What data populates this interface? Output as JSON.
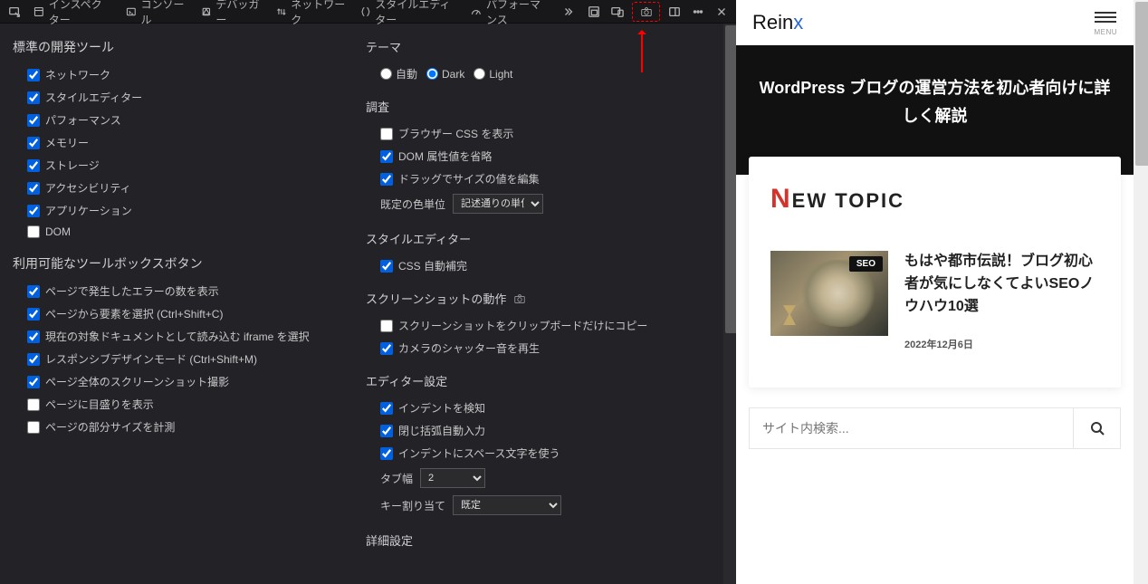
{
  "toolbar": {
    "tabs": [
      {
        "id": "inspector",
        "label": "インスペクター"
      },
      {
        "id": "console",
        "label": "コンソール"
      },
      {
        "id": "debugger",
        "label": "デバッガー"
      },
      {
        "id": "network",
        "label": "ネットワーク"
      },
      {
        "id": "styleeditor",
        "label": "スタイルエディター"
      },
      {
        "id": "performance",
        "label": "パフォーマンス"
      }
    ]
  },
  "settings": {
    "default_tools": {
      "title": "標準の開発ツール",
      "items": [
        {
          "label": "ネットワーク",
          "checked": true
        },
        {
          "label": "スタイルエディター",
          "checked": true
        },
        {
          "label": "パフォーマンス",
          "checked": true
        },
        {
          "label": "メモリー",
          "checked": true
        },
        {
          "label": "ストレージ",
          "checked": true
        },
        {
          "label": "アクセシビリティ",
          "checked": true
        },
        {
          "label": "アプリケーション",
          "checked": true
        },
        {
          "label": "DOM",
          "checked": false
        }
      ]
    },
    "toolbox_buttons": {
      "title": "利用可能なツールボックスボタン",
      "items": [
        {
          "label": "ページで発生したエラーの数を表示",
          "checked": true
        },
        {
          "label": "ページから要素を選択 (Ctrl+Shift+C)",
          "checked": true
        },
        {
          "label": "現在の対象ドキュメントとして読み込む iframe を選択",
          "checked": true
        },
        {
          "label": "レスポンシブデザインモード (Ctrl+Shift+M)",
          "checked": true
        },
        {
          "label": "ページ全体のスクリーンショット撮影",
          "checked": true
        },
        {
          "label": "ページに目盛りを表示",
          "checked": false
        },
        {
          "label": "ページの部分サイズを計測",
          "checked": false
        }
      ]
    },
    "theme": {
      "title": "テーマ",
      "options": [
        "自動",
        "Dark",
        "Light"
      ],
      "selected": "Dark"
    },
    "inspection": {
      "title": "調査",
      "items": [
        {
          "label": "ブラウザー CSS を表示",
          "checked": false
        },
        {
          "label": "DOM 属性値を省略",
          "checked": true
        },
        {
          "label": "ドラッグでサイズの値を編集",
          "checked": true
        }
      ],
      "color_unit_label": "既定の色単位",
      "color_unit_value": "記述通りの単位"
    },
    "style_editor": {
      "title": "スタイルエディター",
      "items": [
        {
          "label": "CSS 自動補完",
          "checked": true
        }
      ]
    },
    "screenshot": {
      "title": "スクリーンショットの動作",
      "items": [
        {
          "label": "スクリーンショットをクリップボードだけにコピー",
          "checked": false
        },
        {
          "label": "カメラのシャッター音を再生",
          "checked": true
        }
      ]
    },
    "editor": {
      "title": "エディター設定",
      "items": [
        {
          "label": "インデントを検知",
          "checked": true
        },
        {
          "label": "閉じ括弧自動入力",
          "checked": true
        },
        {
          "label": "インデントにスペース文字を使う",
          "checked": true
        }
      ],
      "tab_width_label": "タブ幅",
      "tab_width_value": "2",
      "key_map_label": "キー割り当て",
      "key_map_value": "既定"
    },
    "advanced": {
      "title": "詳細設定"
    }
  },
  "site": {
    "brand_a": "Rein",
    "brand_b": "x",
    "menu_label": "MENU",
    "hero": "WordPress ブログの運営方法を初心者向けに詳しく解説",
    "new_topic_N": "N",
    "new_topic_rest": "EW TOPIC",
    "post": {
      "badge": "SEO",
      "title": "もはや都市伝説！ブログ初心者が気にしなくてよいSEOノウハウ10選",
      "date": "2022年12月6日"
    },
    "search_placeholder": "サイト内検索..."
  }
}
